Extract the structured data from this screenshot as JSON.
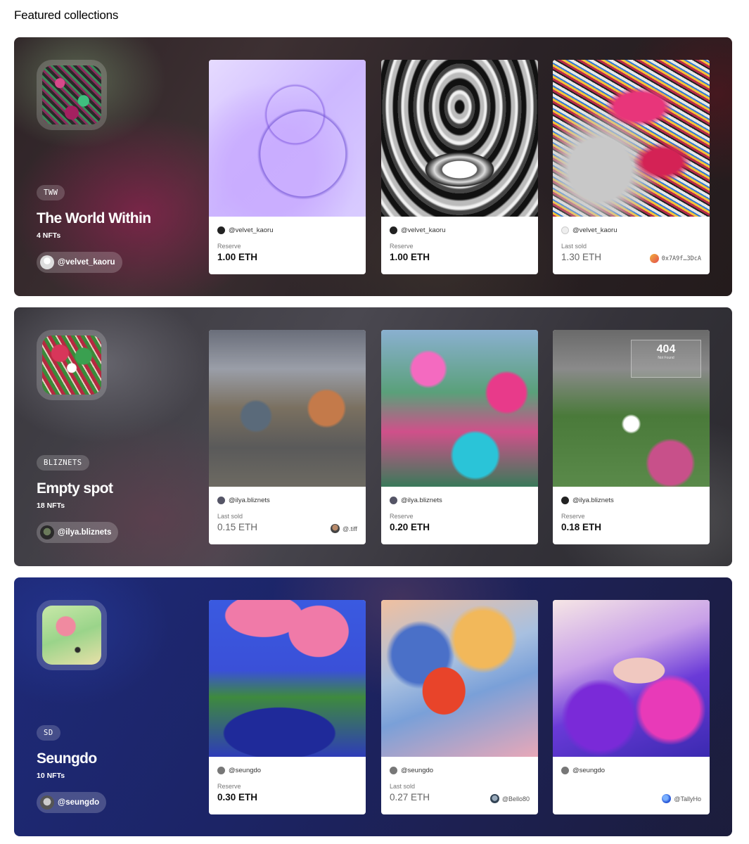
{
  "page": {
    "title": "Featured collections"
  },
  "collections": [
    {
      "tag": "TWW",
      "name": "The World Within",
      "count": "4 NFTs",
      "creator": "@velvet_kaoru",
      "cards": [
        {
          "owner": "@velvet_kaoru",
          "label": "Reserve",
          "price": "1.00 ETH",
          "buyer": ""
        },
        {
          "owner": "@velvet_kaoru",
          "label": "Reserve",
          "price": "1.00 ETH",
          "buyer": ""
        },
        {
          "owner": "@velvet_kaoru",
          "label": "Last sold",
          "price": "1.30 ETH",
          "buyer": "0x7A9f…3DcA"
        }
      ]
    },
    {
      "tag": "BLIZNETS",
      "name": "Empty spot",
      "count": "18 NFTs",
      "creator": "@ilya.bliznets",
      "art_overlay": {
        "code": "404",
        "text": "Not Found"
      },
      "cards": [
        {
          "owner": "@ilya.bliznets",
          "label": "Last sold",
          "price": "0.15 ETH",
          "buyer": "@.tiff"
        },
        {
          "owner": "@ilya.bliznets",
          "label": "Reserve",
          "price": "0.20 ETH",
          "buyer": ""
        },
        {
          "owner": "@ilya.bliznets",
          "label": "Reserve",
          "price": "0.18 ETH",
          "buyer": ""
        }
      ]
    },
    {
      "tag": "SD",
      "name": "Seungdo",
      "count": "10 NFTs",
      "creator": "@seungdo",
      "cards": [
        {
          "owner": "@seungdo",
          "label": "Reserve",
          "price": "0.30 ETH",
          "buyer": ""
        },
        {
          "owner": "@seungdo",
          "label": "Last sold",
          "price": "0.27 ETH",
          "buyer": "@Bello80"
        },
        {
          "owner": "@seungdo",
          "label": "",
          "price": "",
          "buyer": "@TallyHo"
        }
      ]
    }
  ]
}
